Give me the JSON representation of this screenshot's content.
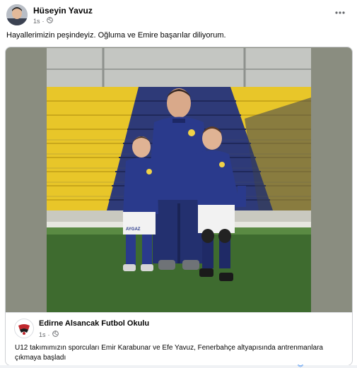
{
  "post": {
    "author": "Hüseyin Yavuz",
    "time": "1s",
    "audience_icon": "globe-icon",
    "caption": "Hayallerimizin peşindeyiz. Oğluma ve Emire başarılar diliyorum.",
    "more_icon": "more-options-icon"
  },
  "shared_post": {
    "page_name": "Edirne Alsancak Futbol Okulu",
    "time": "1s",
    "audience_icon": "globe-icon",
    "text": "U12 takımımızın sporcuları Emir Karabunar ve Efe Yavuz, Fenerbahçe altyapısında antrenmanlara çıkmaya başladı",
    "photo_shirt_text": "AYGAZ"
  },
  "colors": {
    "secondary_text": "#65676b",
    "kit_navy": "#2a3a8c",
    "stand_yellow": "#e8c629",
    "pitch_green": "#3e6b2f",
    "link_blue": "#1877f2"
  }
}
